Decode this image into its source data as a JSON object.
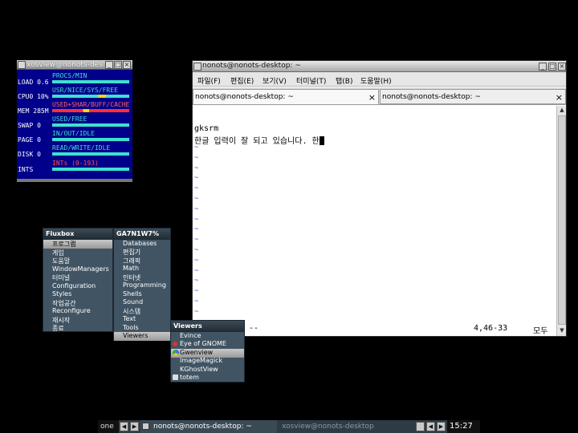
{
  "xosview": {
    "title": "xosview@nonots-desktop",
    "rows": [
      {
        "label": "LOAD  0.6",
        "legend": "PROCS/MIN"
      },
      {
        "label": "CPU0 10%",
        "legend": "USR/NICE/SYS/FREE"
      },
      {
        "label": "MEM  285M",
        "legend": "USED+SHAR/BUFF/CACHE"
      },
      {
        "label": "SWAP    0",
        "legend": "USED/FREE"
      },
      {
        "label": "PAGE    0",
        "legend": "IN/OUT/IDLE"
      },
      {
        "label": "DISK    0",
        "legend": "READ/WRITE/IDLE"
      },
      {
        "label": "INTS",
        "legend": "INTs (0-193)"
      }
    ]
  },
  "terminal": {
    "title": "nonots@nonots-desktop: ~",
    "menu": [
      "파일(F)",
      "편집(E)",
      "보기(V)",
      "터미널(T)",
      "탭(B)",
      "도움말(H)"
    ],
    "tabs": [
      {
        "label": "nonots@nonots-desktop: ~",
        "close": "×"
      },
      {
        "label": "nonots@nonots-desktop: ~",
        "close": "×"
      }
    ],
    "lines": [
      "gksrm",
      "한글 입력이 잘 되고 있습니다. 한"
    ],
    "tilde": "~",
    "status_left": "--",
    "status_pos": "4,46-33",
    "status_right": "모두"
  },
  "fluxbox_menu": {
    "title": "Fluxbox",
    "items": [
      "프로그램",
      "게임",
      "도움말",
      "WindowManagers",
      "터미널",
      "Configuration",
      "Styles",
      "작업공간",
      "Reconfigure",
      "재시작",
      "종료"
    ]
  },
  "programs_menu": {
    "title": "GA7N1W7%",
    "items": [
      "Databases",
      "편집기",
      "그래픽",
      "Math",
      "인터넷",
      "Programming",
      "Shells",
      "Sound",
      "시스템",
      "Text",
      "Tools",
      "Viewers"
    ]
  },
  "viewers_menu": {
    "title": "Viewers",
    "items": [
      "Evince",
      "Eye of GNOME",
      "Gwenview",
      "ImageMagick",
      "KGhostView",
      "totem"
    ]
  },
  "taskbar": {
    "workspace": "one",
    "task1": "nonots@nonots-desktop: ~",
    "task2": "xosview@nonots-desktop",
    "clock": "15:27"
  }
}
